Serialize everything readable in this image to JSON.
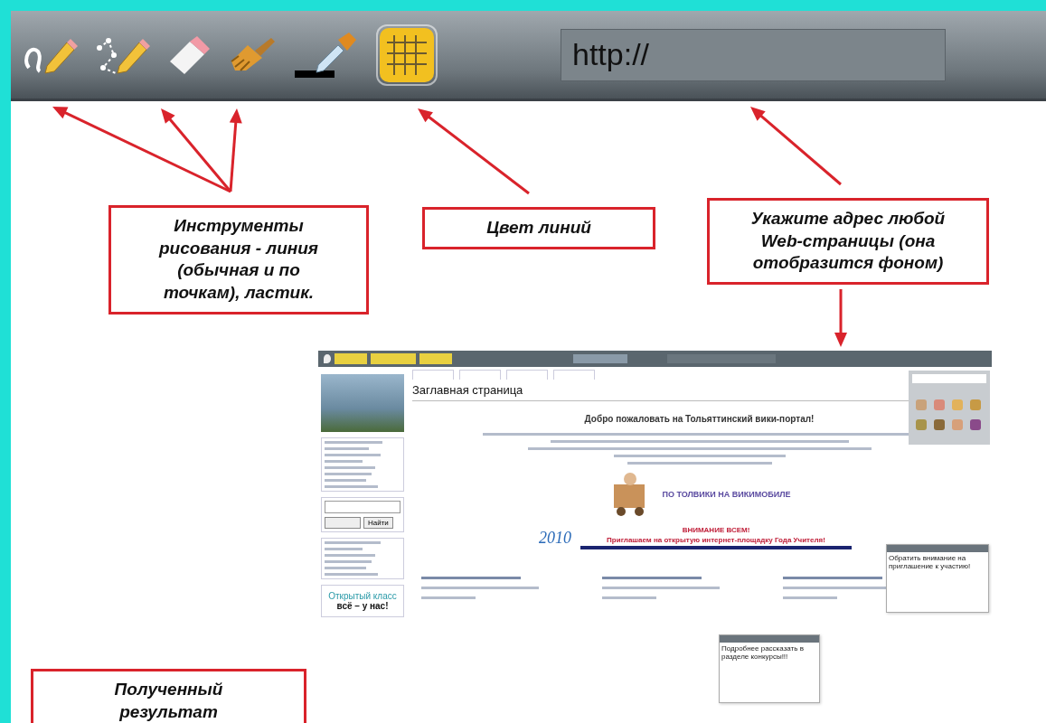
{
  "toolbar": {
    "url_field": {
      "value": "http://"
    },
    "tools": [
      {
        "kind": "freehand",
        "selected": false
      },
      {
        "kind": "polyline",
        "selected": false
      },
      {
        "kind": "eraser",
        "selected": false
      },
      {
        "kind": "brush",
        "selected": false
      },
      {
        "kind": "color",
        "selected": false
      },
      {
        "kind": "grid",
        "selected": true
      }
    ]
  },
  "callouts": [
    {
      "lines": [
        "Инструменты",
        "рисования - линия",
        "(обычная и по",
        "точкам), ластик."
      ]
    },
    {
      "lines": [
        "Цвет линий"
      ]
    },
    {
      "lines": [
        "Укажите адрес любой",
        "Web-страницы (она",
        "отобразится фоном)"
      ]
    },
    {
      "lines": [
        "Полученный",
        "результат"
      ]
    }
  ],
  "webpage": {
    "page_title": "Заглавная страница",
    "welcome": "Добро пожаловать на Тольяттинский вики-портал!",
    "mobile_link": "ПО ТОЛВИКИ НА ВИКИМОБИЛЕ",
    "attention": "ВНИМАНИЕ ВСЕМ!",
    "invite": "Приглашаем на открытую интернет-площадку Года Учителя!",
    "year_badge": "2010",
    "search_buttons": [
      "Найти"
    ],
    "promo": [
      "Открытый класс",
      "всё – у нас!"
    ],
    "sticky_notes": [
      {
        "text": "Обратить внимание на приглашение к участию!"
      },
      {
        "text": "Подробнее рассказать в разделе конкурсы!!!"
      }
    ]
  }
}
